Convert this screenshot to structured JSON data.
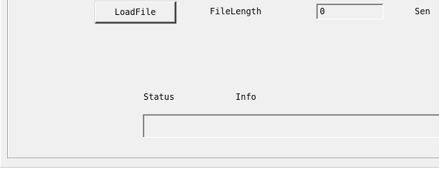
{
  "toolbar": {
    "load_file_label": "LoadFile"
  },
  "file_length": {
    "label": "FileLength",
    "value": "0"
  },
  "send": {
    "label_partial": "Sen"
  },
  "status_section": {
    "status_label": "Status",
    "info_label": "Info",
    "info_value": ""
  },
  "colors": {
    "panel_background": "#f0f0f0",
    "field_background": "#f0f0f0",
    "text": "#000000"
  }
}
